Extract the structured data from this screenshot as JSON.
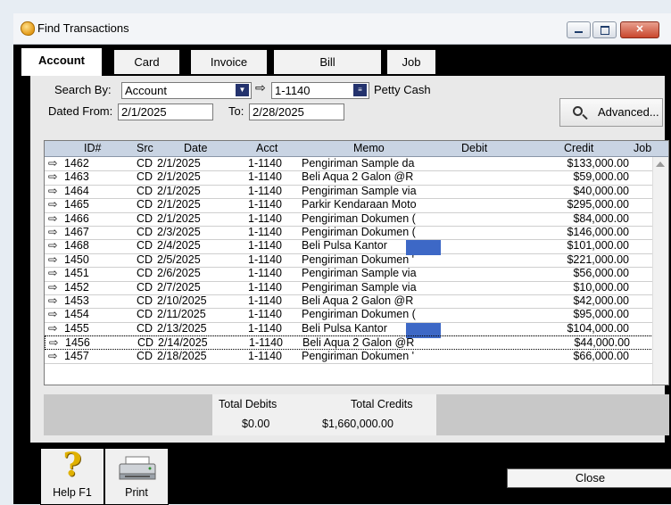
{
  "window": {
    "title": "Find Transactions"
  },
  "tabs": [
    {
      "label": "Account",
      "active": true
    },
    {
      "label": "Card",
      "active": false
    },
    {
      "label": "Invoice",
      "active": false
    },
    {
      "label": "Bill",
      "active": false
    },
    {
      "label": "Job",
      "active": false
    }
  ],
  "search": {
    "search_by_label": "Search By:",
    "search_by_value": "Account",
    "account_code": "1-1140",
    "account_name": "Petty Cash",
    "dated_from_label": "Dated From:",
    "dated_from": "2/1/2025",
    "to_label": "To:",
    "to_date": "2/28/2025",
    "advanced_label": "Advanced..."
  },
  "table": {
    "columns": [
      "ID#",
      "Src",
      "Date",
      "Acct",
      "Memo",
      "Debit",
      "Credit",
      "Job"
    ],
    "rows": [
      {
        "id": "1462",
        "src": "CD",
        "date": "2/1/2025",
        "acct": "1-1140",
        "memo": "Pengiriman Sample da",
        "debit": "",
        "credit": "$133,000.00",
        "job": ""
      },
      {
        "id": "1463",
        "src": "CD",
        "date": "2/1/2025",
        "acct": "1-1140",
        "memo": "Beli Aqua 2 Galon @R",
        "debit": "",
        "credit": "$59,000.00",
        "job": ""
      },
      {
        "id": "1464",
        "src": "CD",
        "date": "2/1/2025",
        "acct": "1-1140",
        "memo": "Pengiriman Sample via",
        "debit": "",
        "credit": "$40,000.00",
        "job": ""
      },
      {
        "id": "1465",
        "src": "CD",
        "date": "2/1/2025",
        "acct": "1-1140",
        "memo": "Parkir Kendaraan Moto",
        "debit": "",
        "credit": "$295,000.00",
        "job": ""
      },
      {
        "id": "1466",
        "src": "CD",
        "date": "2/1/2025",
        "acct": "1-1140",
        "memo": "Pengiriman Dokumen (",
        "debit": "",
        "credit": "$84,000.00",
        "job": ""
      },
      {
        "id": "1467",
        "src": "CD",
        "date": "2/3/2025",
        "acct": "1-1140",
        "memo": "Pengiriman Dokumen (",
        "debit": "",
        "credit": "$146,000.00",
        "job": ""
      },
      {
        "id": "1468",
        "src": "CD",
        "date": "2/4/2025",
        "acct": "1-1140",
        "memo": "Beli Pulsa Kantor",
        "debit": "",
        "credit": "$101,000.00",
        "job": ""
      },
      {
        "id": "1450",
        "src": "CD",
        "date": "2/5/2025",
        "acct": "1-1140",
        "memo": "Pengiriman Dokumen '",
        "debit": "",
        "credit": "$221,000.00",
        "job": ""
      },
      {
        "id": "1451",
        "src": "CD",
        "date": "2/6/2025",
        "acct": "1-1140",
        "memo": "Pengiriman Sample via",
        "debit": "",
        "credit": "$56,000.00",
        "job": ""
      },
      {
        "id": "1452",
        "src": "CD",
        "date": "2/7/2025",
        "acct": "1-1140",
        "memo": "Pengiriman Sample via",
        "debit": "",
        "credit": "$10,000.00",
        "job": ""
      },
      {
        "id": "1453",
        "src": "CD",
        "date": "2/10/2025",
        "acct": "1-1140",
        "memo": "Beli Aqua 2 Galon @R",
        "debit": "",
        "credit": "$42,000.00",
        "job": ""
      },
      {
        "id": "1454",
        "src": "CD",
        "date": "2/11/2025",
        "acct": "1-1140",
        "memo": "Pengiriman Dokumen (",
        "debit": "",
        "credit": "$95,000.00",
        "job": ""
      },
      {
        "id": "1455",
        "src": "CD",
        "date": "2/13/2025",
        "acct": "1-1140",
        "memo": "Beli Pulsa Kantor",
        "debit": "",
        "credit": "$104,000.00",
        "job": ""
      },
      {
        "id": "1456",
        "src": "CD",
        "date": "2/14/2025",
        "acct": "1-1140",
        "memo": "Beli Aqua 2 Galon @R",
        "debit": "",
        "credit": "$44,000.00",
        "job": ""
      },
      {
        "id": "1457",
        "src": "CD",
        "date": "2/18/2025",
        "acct": "1-1140",
        "memo": "Pengiriman Dokumen '",
        "debit": "",
        "credit": "$66,000.00",
        "job": ""
      }
    ]
  },
  "totals": {
    "debits_label": "Total Debits",
    "debits_value": "$0.00",
    "credits_label": "Total Credits",
    "credits_value": "$1,660,000.00"
  },
  "buttons": {
    "help": "Help F1",
    "print": "Print",
    "close": "Close"
  },
  "colors": {
    "header": "#c9d4e3",
    "redaction": "#3d68c6",
    "help_icon": "#e0b100"
  }
}
